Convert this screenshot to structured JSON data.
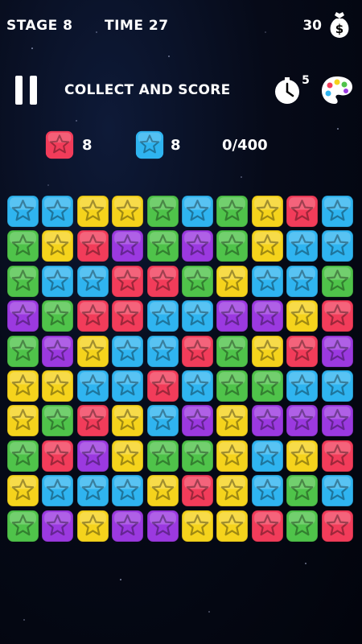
{
  "hud": {
    "stage_label": "STAGE 8",
    "time_label": "TIME 27",
    "coins": "30",
    "moneybag_icon": "money-bag-icon"
  },
  "header": {
    "title": "COLLECT AND SCORE",
    "timer_badge": "5",
    "pause_icon": "pause-icon",
    "timer_icon": "stopwatch-icon",
    "palette_icon": "paint-palette-icon"
  },
  "goals": {
    "red_count": "8",
    "blue_count": "8",
    "score_progress": "0/400"
  },
  "colors": {
    "blue": "#2fb4f0",
    "yellow": "#f5d31c",
    "green": "#4fc34a",
    "red": "#f23c5a",
    "purple": "#9b39e0"
  },
  "board": [
    [
      "blue",
      "blue",
      "yellow",
      "yellow",
      "green",
      "blue",
      "green",
      "yellow",
      "red",
      "blue"
    ],
    [
      "green",
      "yellow",
      "red",
      "purple",
      "green",
      "purple",
      "green",
      "yellow",
      "blue",
      "blue"
    ],
    [
      "green",
      "blue",
      "blue",
      "red",
      "red",
      "green",
      "yellow",
      "blue",
      "blue",
      "green"
    ],
    [
      "purple",
      "green",
      "red",
      "red",
      "blue",
      "blue",
      "purple",
      "purple",
      "yellow",
      "red"
    ],
    [
      "green",
      "purple",
      "yellow",
      "blue",
      "blue",
      "red",
      "green",
      "yellow",
      "red",
      "purple"
    ],
    [
      "yellow",
      "yellow",
      "blue",
      "blue",
      "red",
      "blue",
      "green",
      "green",
      "blue",
      "blue"
    ],
    [
      "yellow",
      "green",
      "red",
      "yellow",
      "blue",
      "purple",
      "yellow",
      "purple",
      "purple",
      "purple"
    ],
    [
      "green",
      "red",
      "purple",
      "yellow",
      "green",
      "green",
      "yellow",
      "blue",
      "yellow",
      "red"
    ],
    [
      "yellow",
      "blue",
      "blue",
      "blue",
      "yellow",
      "red",
      "yellow",
      "blue",
      "green",
      "blue"
    ],
    [
      "green",
      "purple",
      "yellow",
      "purple",
      "purple",
      "yellow",
      "yellow",
      "red",
      "green",
      "red"
    ]
  ]
}
